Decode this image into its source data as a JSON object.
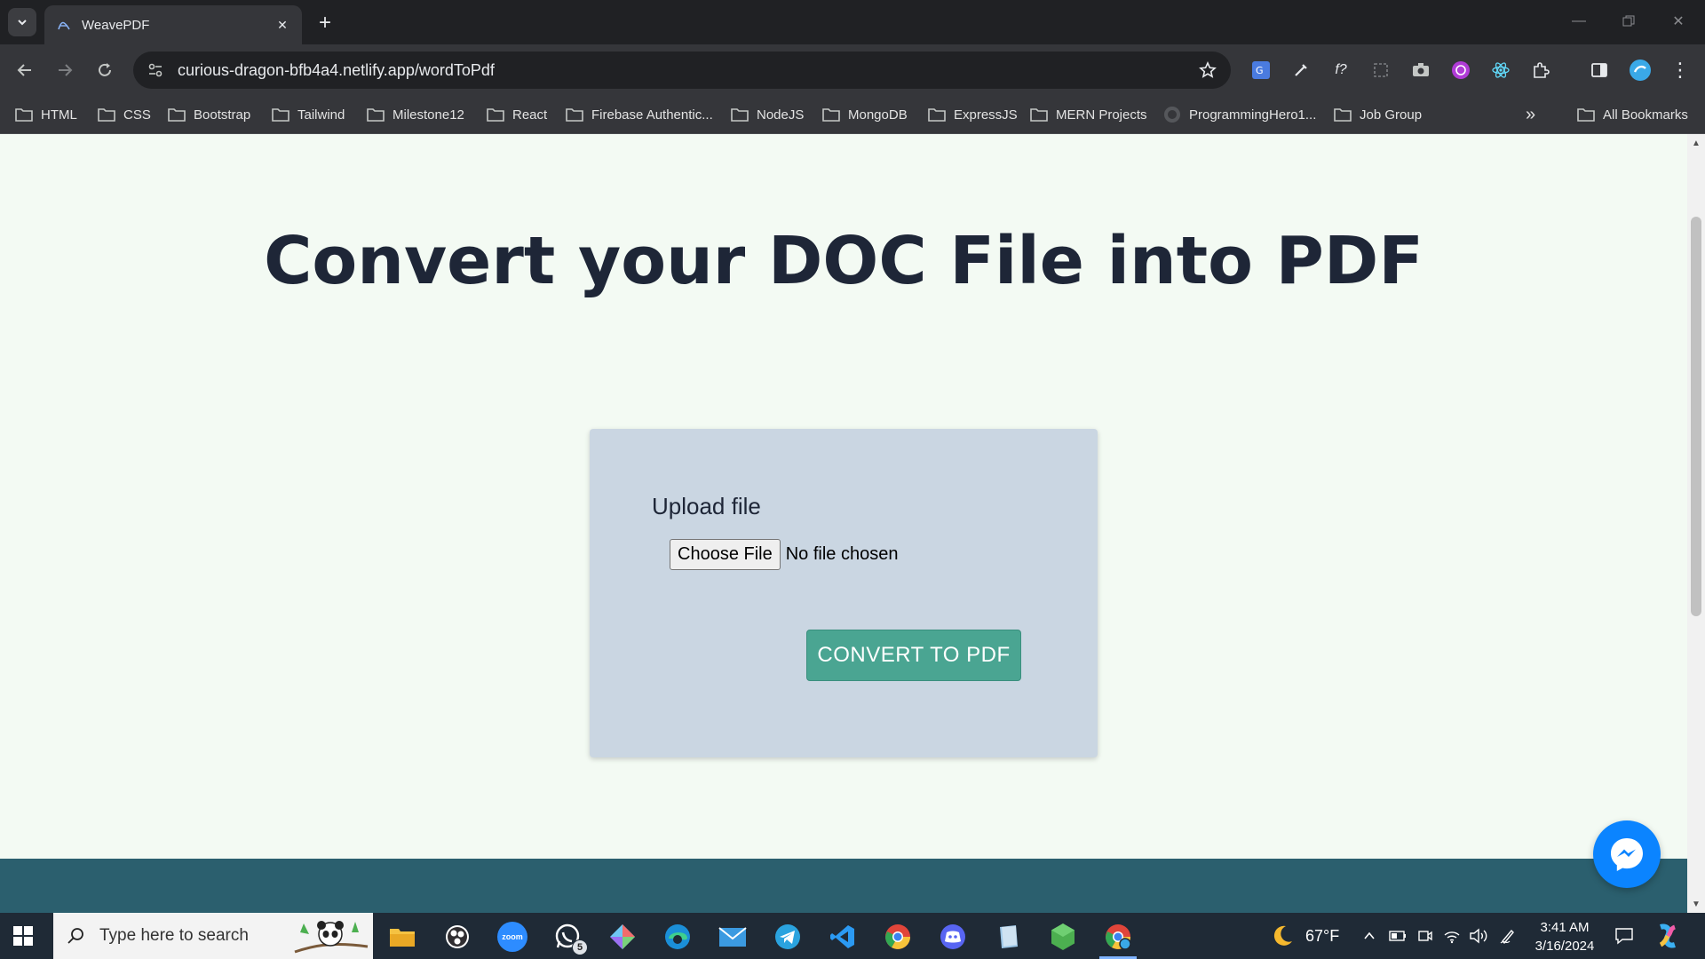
{
  "browser": {
    "tab_title": "WeavePDF",
    "url": "curious-dragon-bfb4a4.netlify.app/wordToPdf",
    "bookmarks": [
      "HTML",
      "CSS",
      "Bootstrap",
      "Tailwind",
      "Milestone12",
      "React",
      "Firebase Authentic...",
      "NodeJS",
      "MongoDB",
      "ExpressJS",
      "MERN Projects",
      "ProgrammingHero1...",
      "Job Group"
    ],
    "all_bookmarks": "All Bookmarks"
  },
  "page": {
    "title": "Convert your DOC File into PDF",
    "upload_label": "Upload file",
    "choose_file_label": "Choose File",
    "file_status": "No file chosen",
    "convert_label": "CONVERT TO PDF"
  },
  "taskbar": {
    "search_placeholder": "Type here to search",
    "whatsapp_badge": "5",
    "weather_temp": "67°F",
    "time": "3:41 AM",
    "date": "3/16/2024"
  },
  "colors": {
    "page_bg": "#f3faf3",
    "card_bg": "#cad6e2",
    "convert_button": "#4aa592",
    "footer": "#2b5f6e",
    "title_text": "#1e2637"
  }
}
